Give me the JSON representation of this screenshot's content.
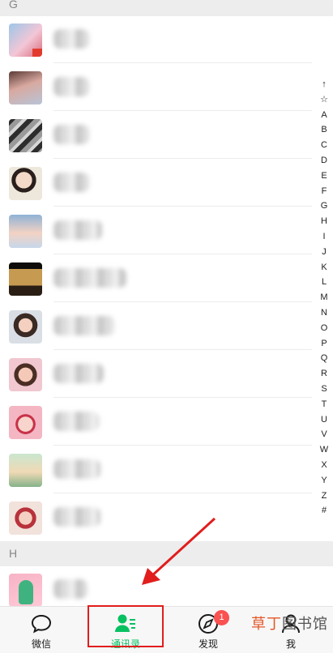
{
  "sections": [
    {
      "letter": "G"
    },
    {
      "letter": "H"
    }
  ],
  "contacts_g_count": 11,
  "index_letters": [
    "↑",
    "☆",
    "A",
    "B",
    "C",
    "D",
    "E",
    "F",
    "G",
    "H",
    "I",
    "J",
    "K",
    "L",
    "M",
    "N",
    "O",
    "P",
    "Q",
    "R",
    "S",
    "T",
    "U",
    "V",
    "W",
    "X",
    "Y",
    "Z",
    "#"
  ],
  "tabs": [
    {
      "label": "微信",
      "icon": "chat-bubble-icon"
    },
    {
      "label": "通讯录",
      "icon": "contacts-icon",
      "active": true
    },
    {
      "label": "发现",
      "icon": "compass-icon",
      "badge": "1"
    },
    {
      "label": "我",
      "icon": "person-icon"
    }
  ],
  "watermark": {
    "part1": "草丁",
    "part2": "图书馆"
  },
  "colors": {
    "accent": "#07c160",
    "badge": "#fa5151",
    "annotation": "#e11d1d"
  }
}
